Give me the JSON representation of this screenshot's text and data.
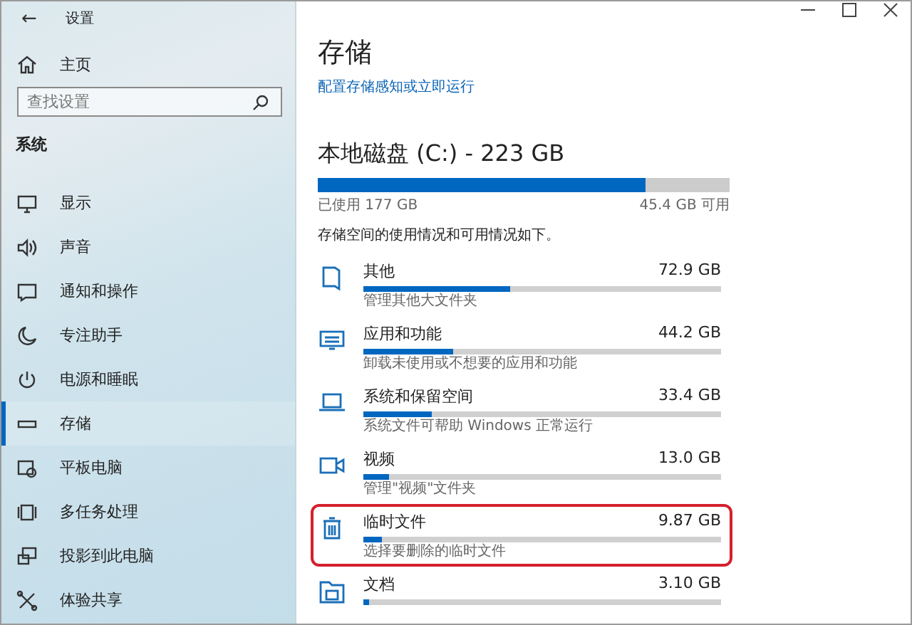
{
  "window": {
    "back": "←",
    "title": "设置",
    "controls": [
      {
        "kind": "minimize"
      },
      {
        "kind": "maximize"
      },
      {
        "kind": "close"
      }
    ]
  },
  "sidebar": {
    "home": "主页",
    "search": {
      "placeholder": "查找设置"
    },
    "section": "系统",
    "items": [
      {
        "kind": "display",
        "label": "显示",
        "selected": false
      },
      {
        "kind": "sound",
        "label": "声音",
        "selected": false
      },
      {
        "kind": "notify",
        "label": "通知和操作",
        "selected": false
      },
      {
        "kind": "focus",
        "label": "专注助手",
        "selected": false
      },
      {
        "kind": "power",
        "label": "电源和睡眠",
        "selected": false
      },
      {
        "kind": "storage",
        "label": "存储",
        "selected": true
      },
      {
        "kind": "tablet",
        "label": "平板电脑",
        "selected": false
      },
      {
        "kind": "multitask",
        "label": "多任务处理",
        "selected": false
      },
      {
        "kind": "project",
        "label": "投影到此电脑",
        "selected": false
      },
      {
        "kind": "share",
        "label": "体验共享",
        "selected": false
      }
    ]
  },
  "page": {
    "title": "存储",
    "link": "配置存储感知或立即运行",
    "disk": {
      "name": "本地磁盘 (C:) - 223 GB",
      "level": 0.795,
      "used": "已使用 177 GB",
      "free": "45.4 GB 可用"
    },
    "description": "存储空间的使用情况和可用情况如下。",
    "rows": [
      {
        "kind": "other",
        "name": "其他",
        "size": "72.9 GB",
        "level": 0.41,
        "desc": "管理其他大文件夹",
        "highlighted": false
      },
      {
        "kind": "apps",
        "name": "应用和功能",
        "size": "44.2 GB",
        "level": 0.25,
        "desc": "卸载未使用或不想要的应用和功能",
        "highlighted": false
      },
      {
        "kind": "system",
        "name": "系统和保留空间",
        "size": "33.4 GB",
        "level": 0.19,
        "desc": "系统文件可帮助 Windows 正常运行",
        "highlighted": false
      },
      {
        "kind": "video",
        "name": "视频",
        "size": "13.0 GB",
        "level": 0.07,
        "desc": "管理\"视频\"文件夹",
        "highlighted": false
      },
      {
        "kind": "temp",
        "name": "临时文件",
        "size": "9.87 GB",
        "level": 0.05,
        "desc": "选择要删除的临时文件",
        "highlighted": true
      },
      {
        "kind": "docs",
        "name": "文档",
        "size": "3.10 GB",
        "level": 0.015,
        "highlighted": false
      }
    ]
  }
}
